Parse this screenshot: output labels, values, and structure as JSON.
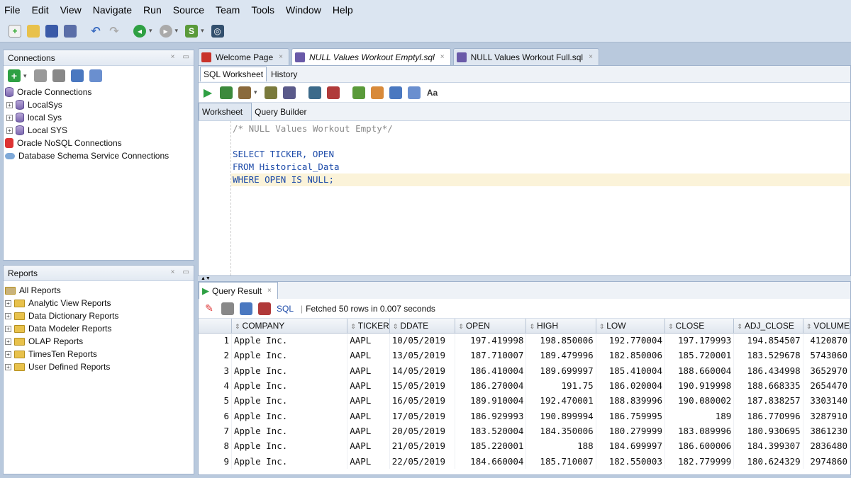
{
  "menu": [
    "File",
    "Edit",
    "View",
    "Navigate",
    "Run",
    "Source",
    "Team",
    "Tools",
    "Window",
    "Help"
  ],
  "connections": {
    "title": "Connections",
    "items": [
      {
        "label": "Oracle Connections",
        "level": 0,
        "icon": "database-icon"
      },
      {
        "label": "LocalSys",
        "level": 1,
        "icon": "database-icon"
      },
      {
        "label": "local Sys",
        "level": 1,
        "icon": "database-icon"
      },
      {
        "label": "Local SYS",
        "level": 1,
        "icon": "database-icon"
      },
      {
        "label": "Oracle NoSQL Connections",
        "level": 0,
        "icon": "nosql-icon"
      },
      {
        "label": "Database Schema Service Connections",
        "level": 0,
        "icon": "cloud-icon"
      }
    ]
  },
  "reports": {
    "title": "Reports",
    "items": [
      {
        "label": "All Reports",
        "level": 0
      },
      {
        "label": "Analytic View Reports",
        "level": 1
      },
      {
        "label": "Data Dictionary Reports",
        "level": 1
      },
      {
        "label": "Data Modeler Reports",
        "level": 1
      },
      {
        "label": "OLAP Reports",
        "level": 1
      },
      {
        "label": "TimesTen Reports",
        "level": 1
      },
      {
        "label": "User Defined Reports",
        "level": 1
      }
    ]
  },
  "doc_tabs": [
    {
      "label": "Welcome Page",
      "active": false
    },
    {
      "label": "NULL Values Workout Emptyl.sql",
      "active": true
    },
    {
      "label": "NULL Values Workout Full.sql",
      "active": false
    }
  ],
  "editor": {
    "sub_tabs": [
      "SQL Worksheet",
      "History"
    ],
    "ws_tabs": [
      "Worksheet",
      "Query Builder"
    ],
    "lines": [
      {
        "text": "/* NULL Values Workout Empty*/",
        "kind": "comment"
      },
      {
        "text": "",
        "kind": "plain"
      },
      {
        "text": "SELECT TICKER, OPEN",
        "kind": "code"
      },
      {
        "text": "FROM Historical_Data",
        "kind": "code"
      },
      {
        "text": "WHERE OPEN IS NULL;",
        "kind": "code"
      }
    ]
  },
  "result": {
    "tab_label": "Query Result",
    "sql_label": "SQL",
    "status": "Fetched 50 rows in 0.007 seconds",
    "columns": [
      "COMPANY",
      "TICKER",
      "DDATE",
      "OPEN",
      "HIGH",
      "LOW",
      "CLOSE",
      "ADJ_CLOSE",
      "VOLUME"
    ],
    "rows": [
      [
        "1",
        "Apple Inc.",
        "AAPL",
        "10/05/2019",
        "197.419998",
        "198.850006",
        "192.770004",
        "197.179993",
        "194.854507",
        "4120870"
      ],
      [
        "2",
        "Apple Inc.",
        "AAPL",
        "13/05/2019",
        "187.710007",
        "189.479996",
        "182.850006",
        "185.720001",
        "183.529678",
        "5743060"
      ],
      [
        "3",
        "Apple Inc.",
        "AAPL",
        "14/05/2019",
        "186.410004",
        "189.699997",
        "185.410004",
        "188.660004",
        "186.434998",
        "3652970"
      ],
      [
        "4",
        "Apple Inc.",
        "AAPL",
        "15/05/2019",
        "186.270004",
        "191.75",
        "186.020004",
        "190.919998",
        "188.668335",
        "2654470"
      ],
      [
        "5",
        "Apple Inc.",
        "AAPL",
        "16/05/2019",
        "189.910004",
        "192.470001",
        "188.839996",
        "190.080002",
        "187.838257",
        "3303140"
      ],
      [
        "6",
        "Apple Inc.",
        "AAPL",
        "17/05/2019",
        "186.929993",
        "190.899994",
        "186.759995",
        "189",
        "186.770996",
        "3287910"
      ],
      [
        "7",
        "Apple Inc.",
        "AAPL",
        "20/05/2019",
        "183.520004",
        "184.350006",
        "180.279999",
        "183.089996",
        "180.930695",
        "3861230"
      ],
      [
        "8",
        "Apple Inc.",
        "AAPL",
        "21/05/2019",
        "185.220001",
        "188",
        "184.699997",
        "186.600006",
        "184.399307",
        "2836480"
      ],
      [
        "9",
        "Apple Inc.",
        "AAPL",
        "22/05/2019",
        "184.660004",
        "185.710007",
        "182.550003",
        "182.779999",
        "180.624329",
        "2974860"
      ]
    ]
  },
  "colors": {
    "accent": "#1c4aa8",
    "highlight_line": "#fbf3d9",
    "panel_border": "#9fb2cc"
  }
}
